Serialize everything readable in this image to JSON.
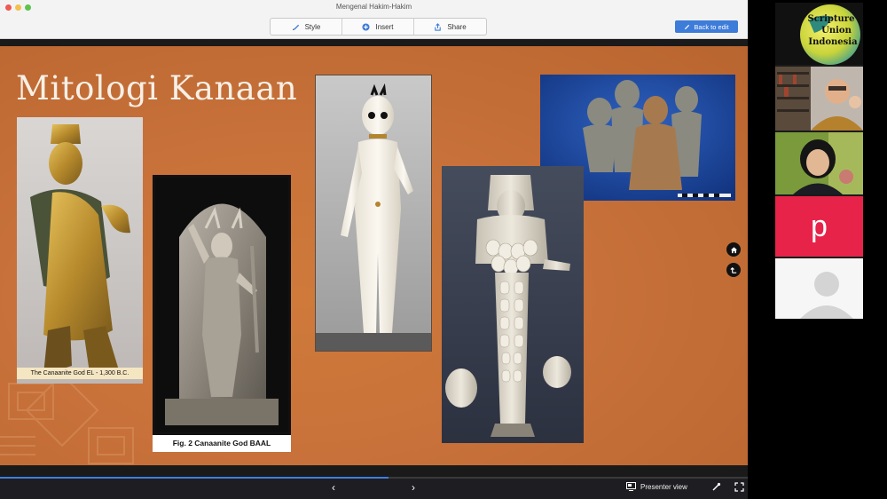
{
  "window": {
    "title": "Mengenal Hakim-Hakim"
  },
  "toolbar": {
    "style_label": "Style",
    "insert_label": "Insert",
    "share_label": "Share",
    "back_label": "Back to edit"
  },
  "slide": {
    "title": "Mitologi Kanaan",
    "captions": {
      "el": "The Canaanite God EL - 1,300 B.C.",
      "baal": "Fig. 2 Canaanite God BAAL"
    },
    "nav": {
      "home_icon": "home-icon",
      "back_icon": "back-arrow-icon"
    }
  },
  "bottombar": {
    "presenter_label": "Presenter view",
    "prev_glyph": "‹",
    "next_glyph": "›",
    "progress": 0.52
  },
  "sidebar": {
    "logo": {
      "line1": "Scripture",
      "line2": "Union",
      "line3": "Indonesia"
    },
    "participant_letter": "p"
  },
  "colors": {
    "slide_bg": "#c8713a",
    "accent_blue": "#3d7cd8",
    "participant_pink": "#e7234a"
  }
}
